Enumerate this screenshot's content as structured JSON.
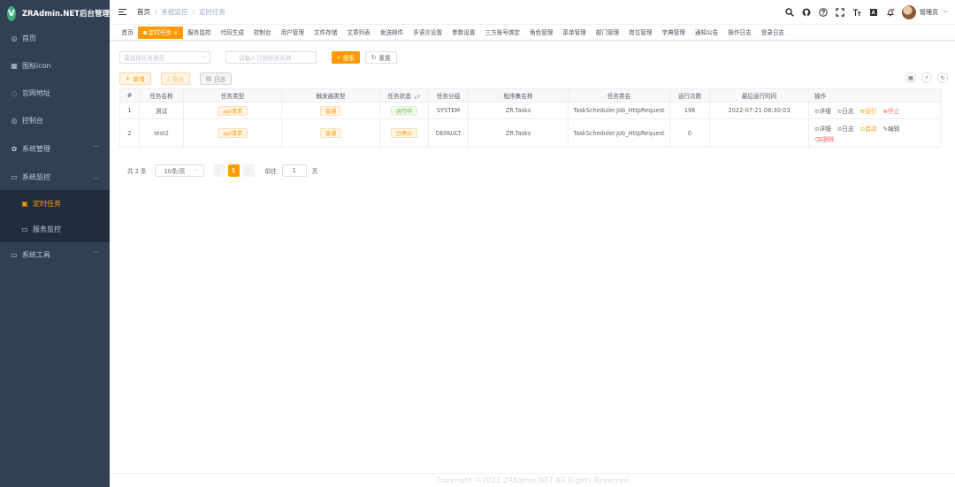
{
  "app": {
    "title": "ZRAdmin.NET后台管理",
    "logo_letter": "V"
  },
  "sidebar": {
    "items": [
      {
        "icon": "dashboard-icon",
        "glyph": "◎",
        "label": "首页"
      },
      {
        "icon": "grid-icon",
        "glyph": "▦",
        "label": "图标icon"
      },
      {
        "icon": "link-icon",
        "glyph": "◌",
        "label": "官网地址"
      },
      {
        "icon": "dashboard-icon",
        "glyph": "◎",
        "label": "控制台"
      },
      {
        "icon": "gear-icon",
        "glyph": "✿",
        "label": "系统管理"
      },
      {
        "icon": "monitor-icon",
        "glyph": "▭",
        "label": "系统监控"
      },
      {
        "icon": "clock-icon",
        "glyph": "▣",
        "label": "定时任务"
      },
      {
        "icon": "server-icon",
        "glyph": "▭",
        "label": "服务监控"
      },
      {
        "icon": "tool-icon",
        "glyph": "▭",
        "label": "系统工具"
      }
    ]
  },
  "breadcrumb": {
    "home": "首页",
    "level1": "系统监控",
    "level2": "定时任务"
  },
  "header": {
    "user_name": "管理员"
  },
  "tags": [
    "首页",
    "定时任务",
    "服务监控",
    "代码生成",
    "控制台",
    "用户管理",
    "文件存储",
    "文章列表",
    "发送邮件",
    "多语言设置",
    "参数设置",
    "三方账号绑定",
    "角色管理",
    "菜单管理",
    "部门管理",
    "岗位管理",
    "字典管理",
    "通知公告",
    "操作日志",
    "登录日志"
  ],
  "filters": {
    "group_placeholder": "请选择任务类型",
    "name_placeholder": "请输入计划任务名称",
    "search_label": "搜索",
    "reset_label": "重置"
  },
  "toolbar": {
    "add_label": "新增",
    "export_label": "导出",
    "log_label": "日志"
  },
  "table": {
    "columns": [
      "#",
      "任务名称",
      "任务类型",
      "触发器类型",
      "任务状态",
      "任务分组",
      "程序集名称",
      "任务类名",
      "运行次数",
      "最后运行时间",
      "操作"
    ],
    "rows": [
      {
        "index": "1",
        "name": "测试",
        "type": "api请求",
        "trigger": "普通",
        "status": "运行中",
        "group": "SYSTEM",
        "assembly": "ZR.Tasks",
        "class": "TaskScheduler.Job_HttpRequest",
        "runs": "196",
        "last_run": "2022-07-21 08:30:03",
        "ops": [
          "详细",
          "日志",
          "运行",
          "停止"
        ]
      },
      {
        "index": "2",
        "name": "test2",
        "type": "api请求",
        "trigger": "普通",
        "status": "已停止",
        "group": "DEFAULT",
        "assembly": "ZR.Tasks",
        "class": "TaskScheduler.Job_HttpRequest",
        "runs": "0",
        "last_run": "",
        "ops": [
          "详细",
          "日志",
          "启动",
          "编辑",
          "删除"
        ]
      }
    ]
  },
  "pagination": {
    "total_text": "共 2 条",
    "page_size": "10条/页",
    "current_page": "1",
    "goto_label": "前往",
    "goto_value": "1",
    "page_unit": "页"
  },
  "footer": {
    "text": "Copyright ©2022 ZRAdmin.NET All Rights Reserved"
  },
  "colors": {
    "accent": "#ff9b00",
    "sidebar_bg": "#304156",
    "danger": "#f56c6c",
    "success": "#67c23a"
  }
}
